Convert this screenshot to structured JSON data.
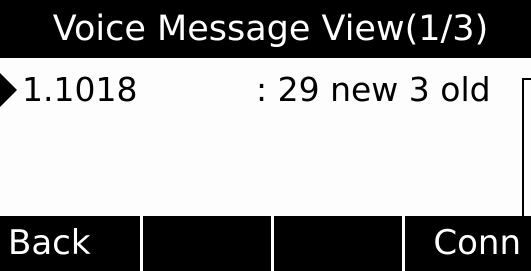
{
  "title": "Voice Message View(1/3)",
  "list": {
    "items": [
      {
        "name": "1.1018",
        "status": ": 29 new 3 old",
        "selected": true
      }
    ]
  },
  "softkeys": [
    "Back",
    "",
    "",
    "Conn"
  ]
}
